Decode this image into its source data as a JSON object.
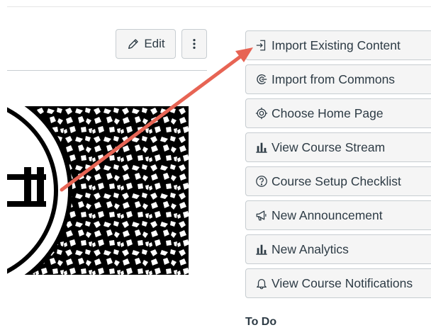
{
  "header": {
    "edit_label": "Edit",
    "more_icon": "kebab-icon"
  },
  "sidebar": {
    "buttons": [
      {
        "label": "Import Existing Content",
        "icon": "import-icon"
      },
      {
        "label": "Import from Commons",
        "icon": "commons-icon"
      },
      {
        "label": "Choose Home Page",
        "icon": "target-icon"
      },
      {
        "label": "View Course Stream",
        "icon": "stats-icon"
      },
      {
        "label": "Course Setup Checklist",
        "icon": "question-icon"
      },
      {
        "label": "New Announcement",
        "icon": "megaphone-icon"
      },
      {
        "label": "New Analytics",
        "icon": "stats-icon"
      },
      {
        "label": "View Course Notifications",
        "icon": "bell-icon"
      }
    ],
    "todo_heading": "To Do"
  },
  "annotation": {
    "color": "#e76454"
  },
  "colors": {
    "button_bg": "#f5f5f5",
    "button_border": "#c7cdd1",
    "text": "#2d3b45"
  }
}
